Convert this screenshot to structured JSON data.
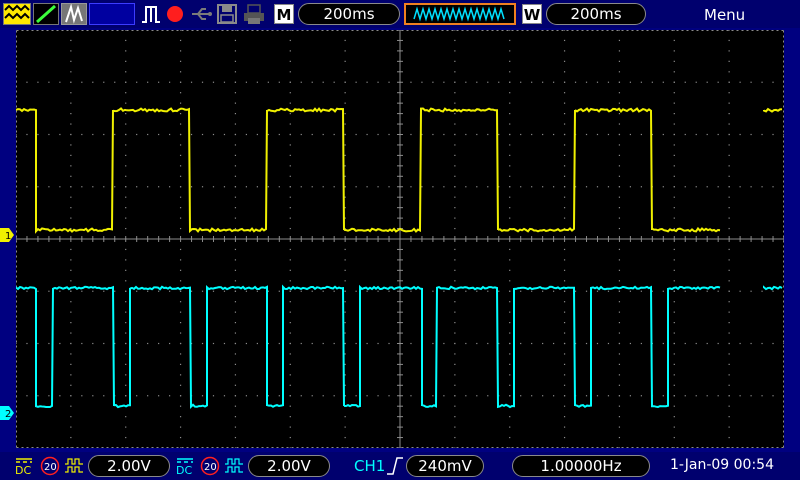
{
  "toolbar": {
    "timebase_tag": "M",
    "timebase": "200ms",
    "window_tag": "W",
    "window_timebase": "200ms",
    "menu": "Menu"
  },
  "channels": [
    {
      "marker": "1",
      "color": "#f0f000",
      "coupling": "DC",
      "bw_limit": "20",
      "scale": "2.00V"
    },
    {
      "marker": "2",
      "color": "#00ffff",
      "coupling": "DC",
      "bw_limit": "20",
      "scale": "2.00V"
    }
  ],
  "trigger": {
    "source": "CH1",
    "level": "240mV"
  },
  "frequency": "1.00000Hz",
  "datetime": "1-Jan-09 00:54",
  "colors": {
    "ch1": "#f0f000",
    "ch2": "#00ffff",
    "frame": "#000080",
    "grid": "#8c8c8c",
    "trigger_label": "#00ffff"
  },
  "icons": [
    "run-waveform-icon",
    "single-trigger-icon",
    "persist-icon",
    "pulse-trigger-icon",
    "record-icon",
    "usb-icon",
    "save-icon",
    "printer-icon"
  ]
}
